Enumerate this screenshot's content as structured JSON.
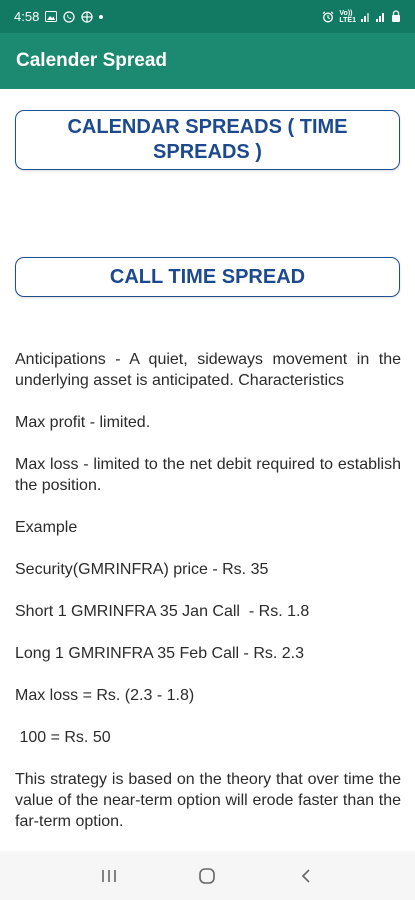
{
  "status_bar": {
    "time": "4:58",
    "left_icons": [
      "gallery-icon",
      "whatsapp-icon",
      "globe-grid-icon",
      "notification-dot"
    ],
    "right_icons": [
      "alarm-icon",
      "volte-lte-icon",
      "signal-icon",
      "signal-icon",
      "lock-battery-icon"
    ],
    "volte_top": "Vo))",
    "volte_bottom": "LTE1"
  },
  "app_bar": {
    "title": "Calender Spread"
  },
  "headings": {
    "calendar": "CALENDAR SPREADS ( TIME SPREADS )",
    "call_time": "CALL TIME SPREAD"
  },
  "body": {
    "anticipations": "Anticipations - A quiet, sideways movement in the underlying asset is anticipated. Characteristics",
    "max_profit": "Max profit - limited.",
    "max_loss": "Max loss - limited to the net debit required to establish the position.",
    "example": "Example",
    "security": "Security(GMRINFRA) price - Rs. 35",
    "short": "Short 1 GMRINFRA 35 Jan Call  - Rs. 1.8",
    "long": "Long 1 GMRINFRA 35 Feb Call - Rs. 2.3",
    "max_loss_calc": "Max loss = Rs. (2.3 - 1.8)",
    "result": " 100 = Rs. 50",
    "strategy": "This strategy is based on the theory that over time the value of the near-term option will erode faster than the far-term option."
  },
  "nav_bar": {
    "buttons": [
      "recents-icon",
      "home-icon",
      "back-icon"
    ]
  },
  "colors": {
    "status_bar": "#127a62",
    "app_bar": "#1c8a70",
    "heading_text": "#1d4a8f",
    "heading_border": "#1f4f8f",
    "body_text": "#2b2b2b"
  }
}
